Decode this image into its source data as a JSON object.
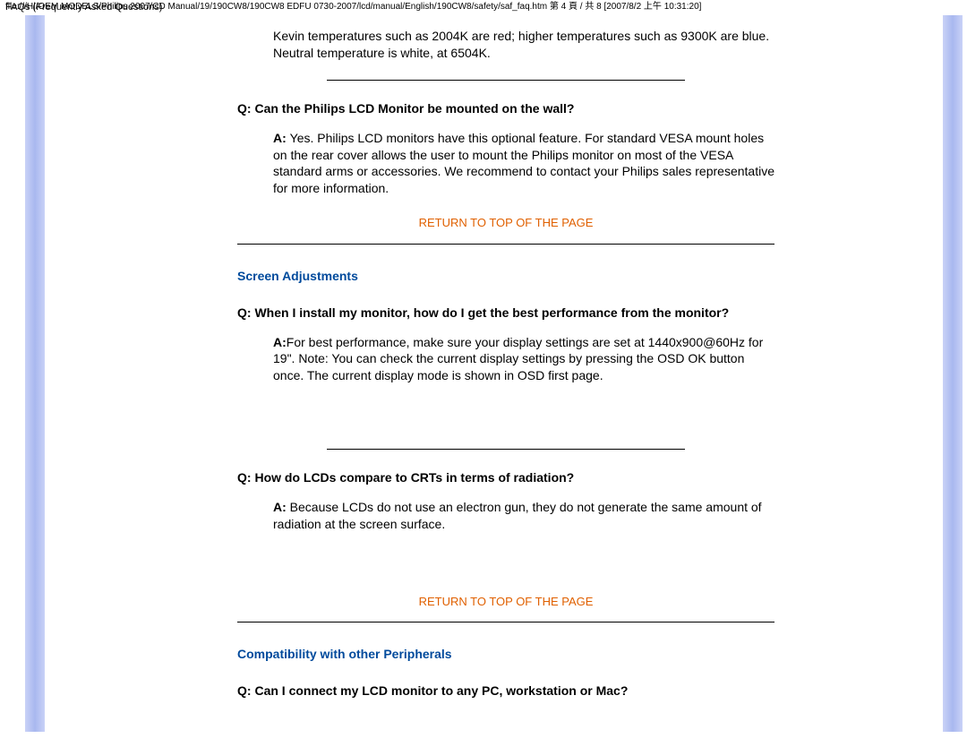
{
  "header": {
    "title": "FAQs (Frequently Asked Questions)"
  },
  "intro_text": "Kevin temperatures such as 2004K are red; higher temperatures such as 9300K are blue. Neutral temperature is white, at 6504K.",
  "q1": {
    "q_prefix": "Q: ",
    "q": "Can the Philips LCD Monitor be mounted on the wall?",
    "a_prefix": "A: ",
    "a": "Yes. Philips LCD monitors have this optional feature. For standard VESA mount holes on the rear cover allows the user to mount the Philips monitor on most of the VESA standard arms or accessories. We recommend to contact your Philips sales representative for more information."
  },
  "return1": "RETURN TO TOP OF THE PAGE",
  "section1": "Screen Adjustments",
  "q2": {
    "q_prefix": "Q: ",
    "q": "When I install my monitor, how do I get the best performance from the monitor?",
    "a_prefix": "A:",
    "a": "For best performance, make sure your display settings are set at 1440x900@60Hz for 19\". Note: You can check the current display settings by pressing the OSD OK button once. The current display mode is shown in OSD first page."
  },
  "q3": {
    "q_prefix": "Q: ",
    "q": "How do LCDs compare to CRTs in terms of radiation?",
    "a_prefix": "A: ",
    "a": "Because LCDs do not use an electron gun, they do not generate the same amount of radiation at the screen surface."
  },
  "return2": "RETURN TO TOP OF THE PAGE",
  "section2": "Compatibility with other Peripherals",
  "q4": {
    "q_prefix": "Q: ",
    "q": "Can I connect my LCD monitor to any PC, workstation or Mac?"
  },
  "footer": "file:///H|/OEM MODELS/Philips 2007/CD Manual/19/190CW8/190CW8 EDFU 0730-2007/lcd/manual/English/190CW8/safety/saf_faq.htm 第 4 頁 / 共 8 [2007/8/2 上午 10:31:20]"
}
